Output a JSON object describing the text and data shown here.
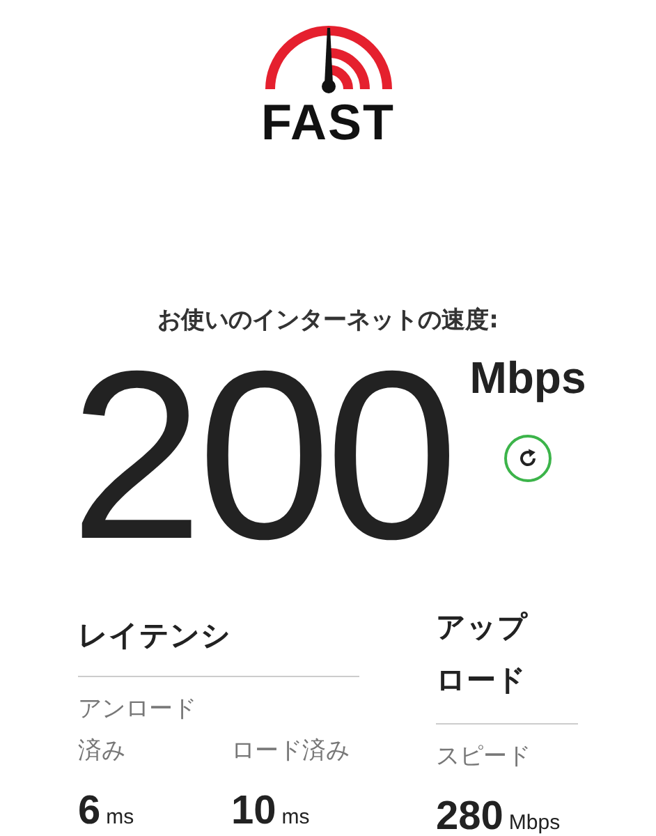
{
  "logo": {
    "text": "FAST"
  },
  "heading": "お使いのインターネットの速度:",
  "speed": {
    "value": "200",
    "unit": "Mbps"
  },
  "latency": {
    "title": "レイテンシ",
    "items": [
      {
        "label": "アンロード済み",
        "value": "6",
        "unit": "ms"
      },
      {
        "label": "ロード済み",
        "value": "10",
        "unit": "ms"
      }
    ]
  },
  "upload": {
    "title": "アップロード",
    "label": "スピード",
    "value": "280",
    "unit": "Mbps"
  }
}
